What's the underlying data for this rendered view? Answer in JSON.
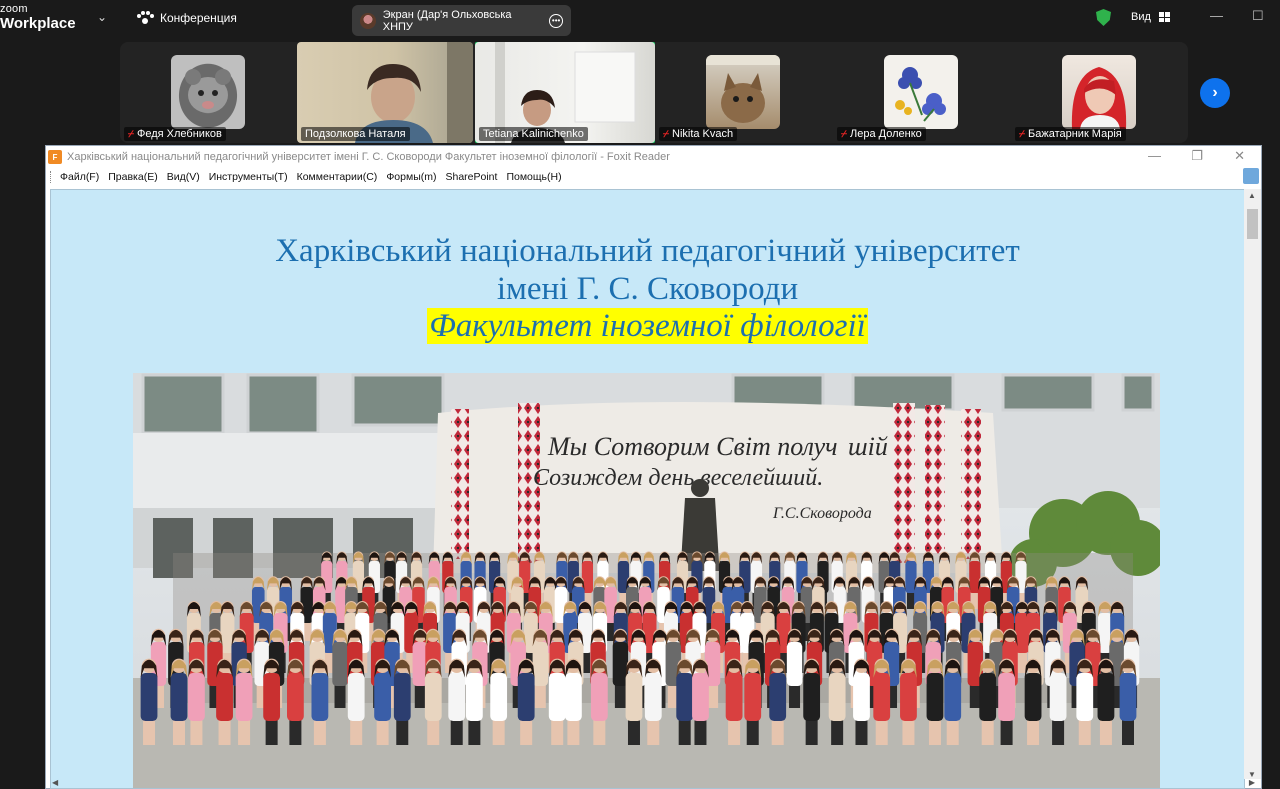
{
  "app": {
    "logo_small": "zoom",
    "logo_big": "Workplace"
  },
  "topbar": {
    "meeting_label": "Конференция",
    "screen_share_label": "Экран (Дар'я Ольховська ХНПУ",
    "view_label": "Вид"
  },
  "participants": [
    {
      "name": "Федя Хлебников",
      "muted": true
    },
    {
      "name": "Подзолкова Наталя",
      "muted": false
    },
    {
      "name": "Tetiana Kalinichenko",
      "muted": false
    },
    {
      "name": "Nikita Kvach",
      "muted": true
    },
    {
      "name": "Лера Доленко",
      "muted": true
    },
    {
      "name": "Бажатарник Марія",
      "muted": true
    }
  ],
  "foxit": {
    "window_title": "Харківський національний педагогічний університет імені Г. С. Сковороди Факультет іноземної філології - Foxit Reader",
    "menu": [
      "Файл(F)",
      "Правка(E)",
      "Вид(V)",
      "Инструменты(T)",
      "Комментарии(C)",
      "Формы(m)",
      "SharePoint",
      "Помощь(H)"
    ]
  },
  "document": {
    "line1": "Харківський національний педагогічний університет",
    "line2": "імені Г. С. Сковороди",
    "line3": "Факультет іноземної філології",
    "photo_inscription_1": "Мы Сотворим Свiт получ",
    "photo_inscription_1b": "шiй",
    "photo_inscription_2": "Созиждем день веселейший.",
    "photo_inscription_3": "Г.С.Сковорода"
  },
  "colors": {
    "accent_green": "#23d96e",
    "zoom_blue": "#0e72ed",
    "doc_bg": "#c7e8f8",
    "title_blue": "#1c6fb0",
    "highlight": "#ffff00"
  }
}
